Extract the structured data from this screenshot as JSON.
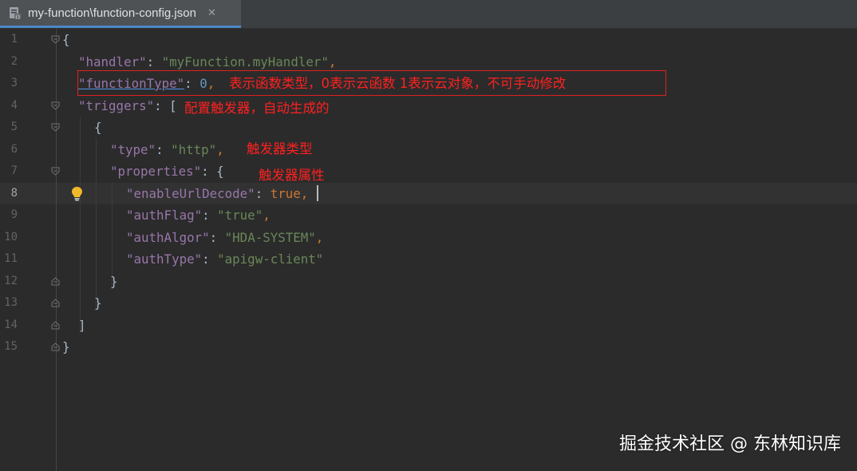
{
  "tab": {
    "title": "my-function\\function-config.json",
    "close_glyph": "✕",
    "icon": "json-file-icon"
  },
  "editor": {
    "line_numbers": [
      "1",
      "2",
      "3",
      "4",
      "5",
      "6",
      "7",
      "8",
      "9",
      "10",
      "11",
      "12",
      "13",
      "14",
      "15"
    ],
    "active_line": "8",
    "lines": [
      [
        {
          "t": "{",
          "c": "p"
        }
      ],
      [
        {
          "t": "\"handler\"",
          "c": "k"
        },
        {
          "t": ": ",
          "c": "p"
        },
        {
          "t": "\"myFunction.myHandler\"",
          "c": "s"
        },
        {
          "t": ",",
          "c": "kw"
        }
      ],
      [
        {
          "t": "\"functionType\"",
          "c": "link"
        },
        {
          "t": ": ",
          "c": "p"
        },
        {
          "t": "0",
          "c": "n"
        },
        {
          "t": ",",
          "c": "kw"
        }
      ],
      [
        {
          "t": "\"triggers\"",
          "c": "k"
        },
        {
          "t": ": [",
          "c": "p"
        }
      ],
      [
        {
          "t": "{",
          "c": "p"
        }
      ],
      [
        {
          "t": "\"type\"",
          "c": "k"
        },
        {
          "t": ": ",
          "c": "p"
        },
        {
          "t": "\"http\"",
          "c": "s"
        },
        {
          "t": ",",
          "c": "kw"
        }
      ],
      [
        {
          "t": "\"properties\"",
          "c": "k"
        },
        {
          "t": ": {",
          "c": "p"
        }
      ],
      [
        {
          "t": "\"enableUrlDecode\"",
          "c": "k"
        },
        {
          "t": ": ",
          "c": "p"
        },
        {
          "t": "true",
          "c": "kw"
        },
        {
          "t": ",",
          "c": "kw"
        }
      ],
      [
        {
          "t": "\"authFlag\"",
          "c": "k"
        },
        {
          "t": ": ",
          "c": "p"
        },
        {
          "t": "\"true\"",
          "c": "s"
        },
        {
          "t": ",",
          "c": "kw"
        }
      ],
      [
        {
          "t": "\"authAlgor\"",
          "c": "k"
        },
        {
          "t": ": ",
          "c": "p"
        },
        {
          "t": "\"HDA-SYSTEM\"",
          "c": "s"
        },
        {
          "t": ",",
          "c": "kw"
        }
      ],
      [
        {
          "t": "\"authType\"",
          "c": "k"
        },
        {
          "t": ": ",
          "c": "p"
        },
        {
          "t": "\"apigw-client\"",
          "c": "s"
        }
      ],
      [
        {
          "t": "}",
          "c": "p"
        }
      ],
      [
        {
          "t": "}",
          "c": "p"
        }
      ],
      [
        {
          "t": "]",
          "c": "p"
        }
      ],
      [
        {
          "t": "}",
          "c": "p"
        }
      ]
    ]
  },
  "annotations": {
    "function_type": "表示函数类型，0表示云函数 1表示云对象，不可手动修改",
    "triggers": "配置触发器，自动生成的",
    "trigger_type": "触发器类型",
    "trigger_properties": "触发器属性"
  },
  "watermark": "掘金技术社区 @ 东林知识库",
  "colors": {
    "background": "#2b2b2b",
    "key": "#9876aa",
    "string": "#6a8759",
    "number": "#6897bb",
    "keyword": "#cc7832",
    "annotation": "#ff2020"
  }
}
